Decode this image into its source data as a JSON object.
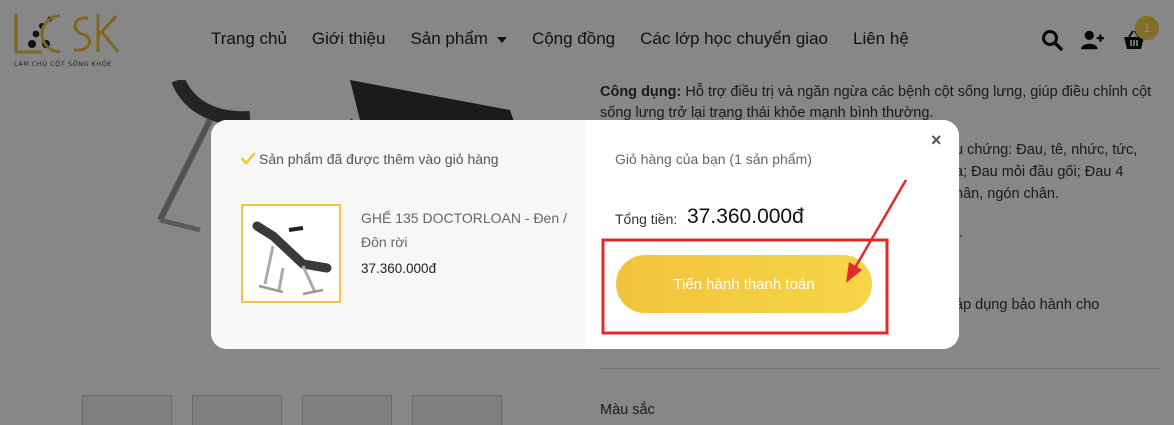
{
  "header": {
    "logo_text": "LCSK",
    "logo_tagline": "LÀM CHỦ CỘT SỐNG KHỎE",
    "nav": [
      {
        "label": "Trang chủ"
      },
      {
        "label": "Giới thiệu"
      },
      {
        "label": "Sản phẩm"
      },
      {
        "label": "Cộng đồng"
      },
      {
        "label": "Các lớp học chuyển giao"
      },
      {
        "label": "Liên hệ"
      }
    ],
    "icons": [
      "search-icon",
      "add-user-icon",
      "cart-icon"
    ],
    "cart_count": "1"
  },
  "background": {
    "usage_label": "Công dụng:",
    "usage_text": "Hỗ trợ điều trị và ngăn ngừa các bệnh cột sống lưng, giúp điều chỉnh cột sống lưng trở lại trạng thái khỏe mạnh bình thường.",
    "symptoms_line1": "u chứng: Đau, tê, nhức, tức,",
    "symptoms_line2": "a; Đau mỏi đầu gối; Đau 4",
    "symptoms_line3": "hân, ngón chân.",
    "ellipsis": "..",
    "warranty_text": "áp dụng bảo hành cho",
    "color_label": "Màu sắc"
  },
  "modal": {
    "added_message": "Sản phẩm đã được thêm vào giỏ hàng",
    "item": {
      "name": "GHẾ 135 DOCTORLOAN - Đen / Đôn rời",
      "price": "37.360.000đ"
    },
    "cart_heading": "Giỏ hàng của bạn (1 sản phẩm)",
    "total_label": "Tổng tiền:",
    "total_value": "37.360.000đ",
    "checkout_label": "Tiến hành thanh toán",
    "close_label": "×"
  },
  "colors": {
    "accent": "#f4c542",
    "badge": "#f6d04d",
    "highlight": "#e22a2a"
  }
}
